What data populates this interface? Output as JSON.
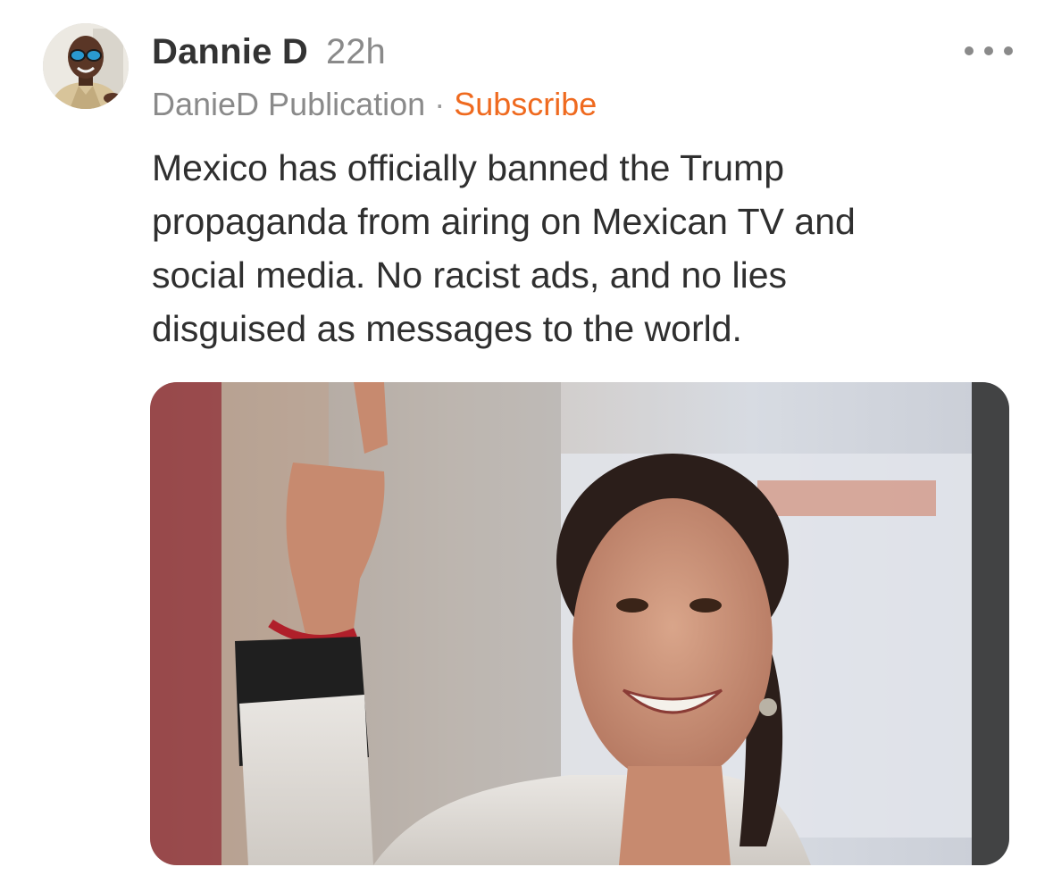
{
  "post": {
    "author": {
      "name": "Dannie D",
      "avatar_icon": "person-with-sunglasses-avatar"
    },
    "time": "22h",
    "publication": "DanieD Publication",
    "separator": "·",
    "subscribe_label": "Subscribe",
    "more_icon": "ellipsis-horizontal-icon",
    "text": "Mexico has officially banned the Trump\npropaganda from airing on Mexican TV and\nsocial media. No racist ads, and no lies\ndisguised as messages to the world."
  },
  "colors": {
    "accent": "#ef6a1f",
    "muted_text": "#8a8a8a",
    "body_text": "#2f2f2f"
  }
}
